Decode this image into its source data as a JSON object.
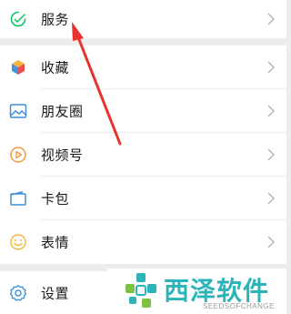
{
  "menu_top": {
    "items": [
      {
        "label": "服务",
        "icon": "service-check-icon",
        "color": "#07c160"
      }
    ]
  },
  "menu_main": {
    "items": [
      {
        "label": "收藏",
        "icon": "favorites-cube-icon"
      },
      {
        "label": "朋友圈",
        "icon": "moments-photo-icon"
      },
      {
        "label": "视频号",
        "icon": "channels-play-icon"
      },
      {
        "label": "卡包",
        "icon": "card-wallet-icon"
      },
      {
        "label": "表情",
        "icon": "sticker-smile-icon"
      }
    ]
  },
  "menu_bottom": {
    "items": [
      {
        "label": "设置",
        "icon": "settings-gear-icon"
      }
    ]
  },
  "watermark": {
    "brand_cn": "西泽软件",
    "brand_en": "SEEDSOFCHANGE",
    "color": "#2bb4b9"
  },
  "annotation": {
    "type": "red-arrow",
    "points_to": "服务",
    "color": "#e8322e"
  }
}
